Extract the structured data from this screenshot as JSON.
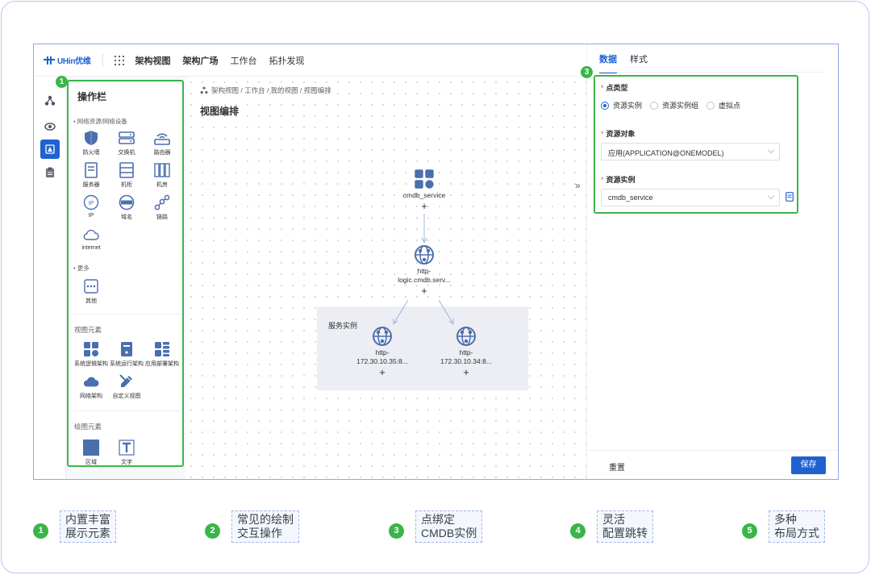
{
  "brand": {
    "logo_text": "UHin优维"
  },
  "topnav": {
    "items": [
      "架构视图",
      "架构广场",
      "工作台",
      "拓扑发现"
    ]
  },
  "ops_panel": {
    "title": "操作栏",
    "section_network": "• 网络资源/网络设备",
    "network_items": [
      "防火墙",
      "交换机",
      "路由器",
      "服务器",
      "机柜",
      "机房",
      "IP",
      "域名",
      "链路",
      "internet"
    ],
    "section_more": "• 更多",
    "more_items": [
      "其他"
    ],
    "section_view": "视图元素",
    "view_items": [
      "系统逻辑架构",
      "系统运行架构",
      "应用部署架构",
      "网络架构",
      "自定义视图"
    ],
    "section_draw": "绘图元素",
    "draw_items": [
      "区域",
      "文字"
    ]
  },
  "canvas": {
    "breadcrumb": "架构视图 / 工作台 / 我的视图 / 视图编排",
    "title": "视图编排",
    "group_label": "服务实例",
    "nodes": [
      {
        "line1": "cmdb_service",
        "line2": ""
      },
      {
        "line1": "http-",
        "line2": "logic.cmdb.serv..."
      },
      {
        "line1": "http-",
        "line2": "172.30.10.35:8..."
      },
      {
        "line1": "http-",
        "line2": "172.30.10.34:8..."
      }
    ],
    "plus": "+",
    "collapse": "»"
  },
  "right_panel": {
    "tabs": [
      "数据",
      "样式"
    ],
    "point_type_label": "点类型",
    "point_type_options": [
      "资源实例",
      "资源实例组",
      "虚拟点"
    ],
    "point_type_selected": "资源实例",
    "resource_object_label": "资源对象",
    "resource_object_value": "应用(APPLICATION@ONEMODEL)",
    "resource_instance_label": "资源实例",
    "resource_instance_value": "cmdb_service",
    "reset_label": "重置",
    "save_label": "保存"
  },
  "badges": [
    "1",
    "3"
  ],
  "features": [
    {
      "num": "1",
      "line1": "内置丰富",
      "line2": "展示元素"
    },
    {
      "num": "2",
      "line1": "常见的绘制",
      "line2": "交互操作"
    },
    {
      "num": "3",
      "line1": "点绑定",
      "line2": "CMDB实例"
    },
    {
      "num": "4",
      "line1": "灵活",
      "line2": "配置跳转"
    },
    {
      "num": "5",
      "line1": "多种",
      "line2": "布局方式"
    }
  ],
  "colors": {
    "primary": "#1e62d0",
    "highlight": "#3bb54a",
    "required": "#e04b4b"
  }
}
